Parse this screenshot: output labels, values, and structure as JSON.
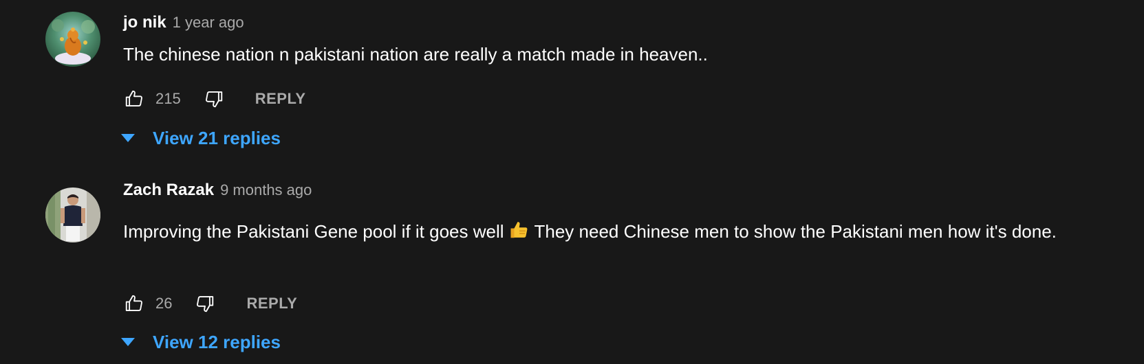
{
  "comments": [
    {
      "author": "jo nik",
      "time": "1 year ago",
      "text": "The chinese nation n pakistani nation are really a match made in heaven..",
      "likes": "215",
      "reply_label": "REPLY",
      "view_replies": "View 21 replies"
    },
    {
      "author": "Zach Razak",
      "time": "9 months ago",
      "text_before_emoji": "Improving the Pakistani Gene pool if it goes well ",
      "emoji": "thumbs-up",
      "text_after_emoji": " They need Chinese men to show the Pakistani men how it's done.",
      "likes": "26",
      "reply_label": "REPLY",
      "view_replies": "View 12 replies"
    }
  ],
  "colors": {
    "background": "#181818",
    "text": "#ffffff",
    "secondary": "#aaaaaa",
    "link": "#3ea6ff"
  }
}
